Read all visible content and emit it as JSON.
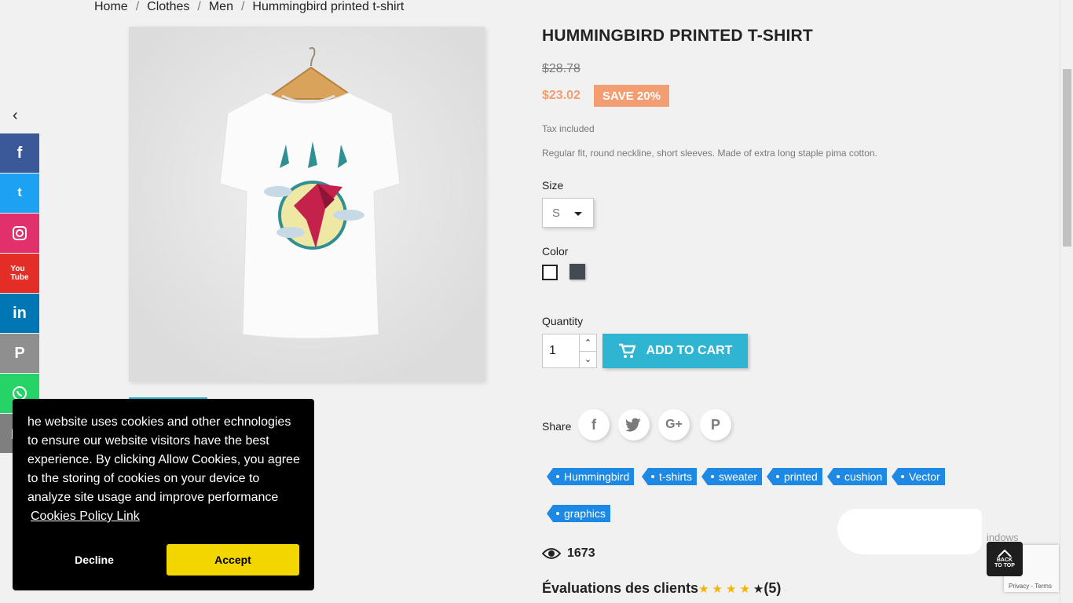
{
  "breadcrumb": [
    "Home",
    "Clothes",
    "Men",
    "Hummingbird printed t-shirt"
  ],
  "product": {
    "title": "HUMMINGBIRD PRINTED T-SHIRT",
    "old_price": "$28.78",
    "price": "$23.02",
    "discount": "SAVE 20%",
    "tax": "Tax included",
    "description": "Regular fit, round neckline, short sleeves. Made of extra long staple pima cotton."
  },
  "options": {
    "size_label": "Size",
    "size_value": "S",
    "color_label": "Color",
    "quantity_label": "Quantity",
    "quantity_value": "1",
    "add_to_cart": "ADD TO CART"
  },
  "share": {
    "label": "Share"
  },
  "tags": [
    "Hummingbird",
    "t-shirts",
    "sweater",
    "printed",
    "cushion",
    "Vector",
    "graphics"
  ],
  "stats": {
    "views": "1673",
    "reviews_label": "Évaluations des clients",
    "reviews_count": "(5)"
  },
  "cookie": {
    "text": "he website uses cookies and other echnologies to ensure our website visitors have the best experience. By clicking Allow Cookies, you agree to the storing of cookies on your device to analyze site usage and improve performance",
    "link": "Cookies Policy Link",
    "decline": "Decline",
    "accept": "Accept"
  },
  "overlay": {
    "windows_text": "indows",
    "back_top": "BACK TO TOP",
    "recaptcha_links": "Privacy - Terms"
  },
  "colors": {
    "accent": "#2fb5d2",
    "discount": "#f39d72",
    "tag": "#1e88e5",
    "accept": "#f1d600"
  }
}
